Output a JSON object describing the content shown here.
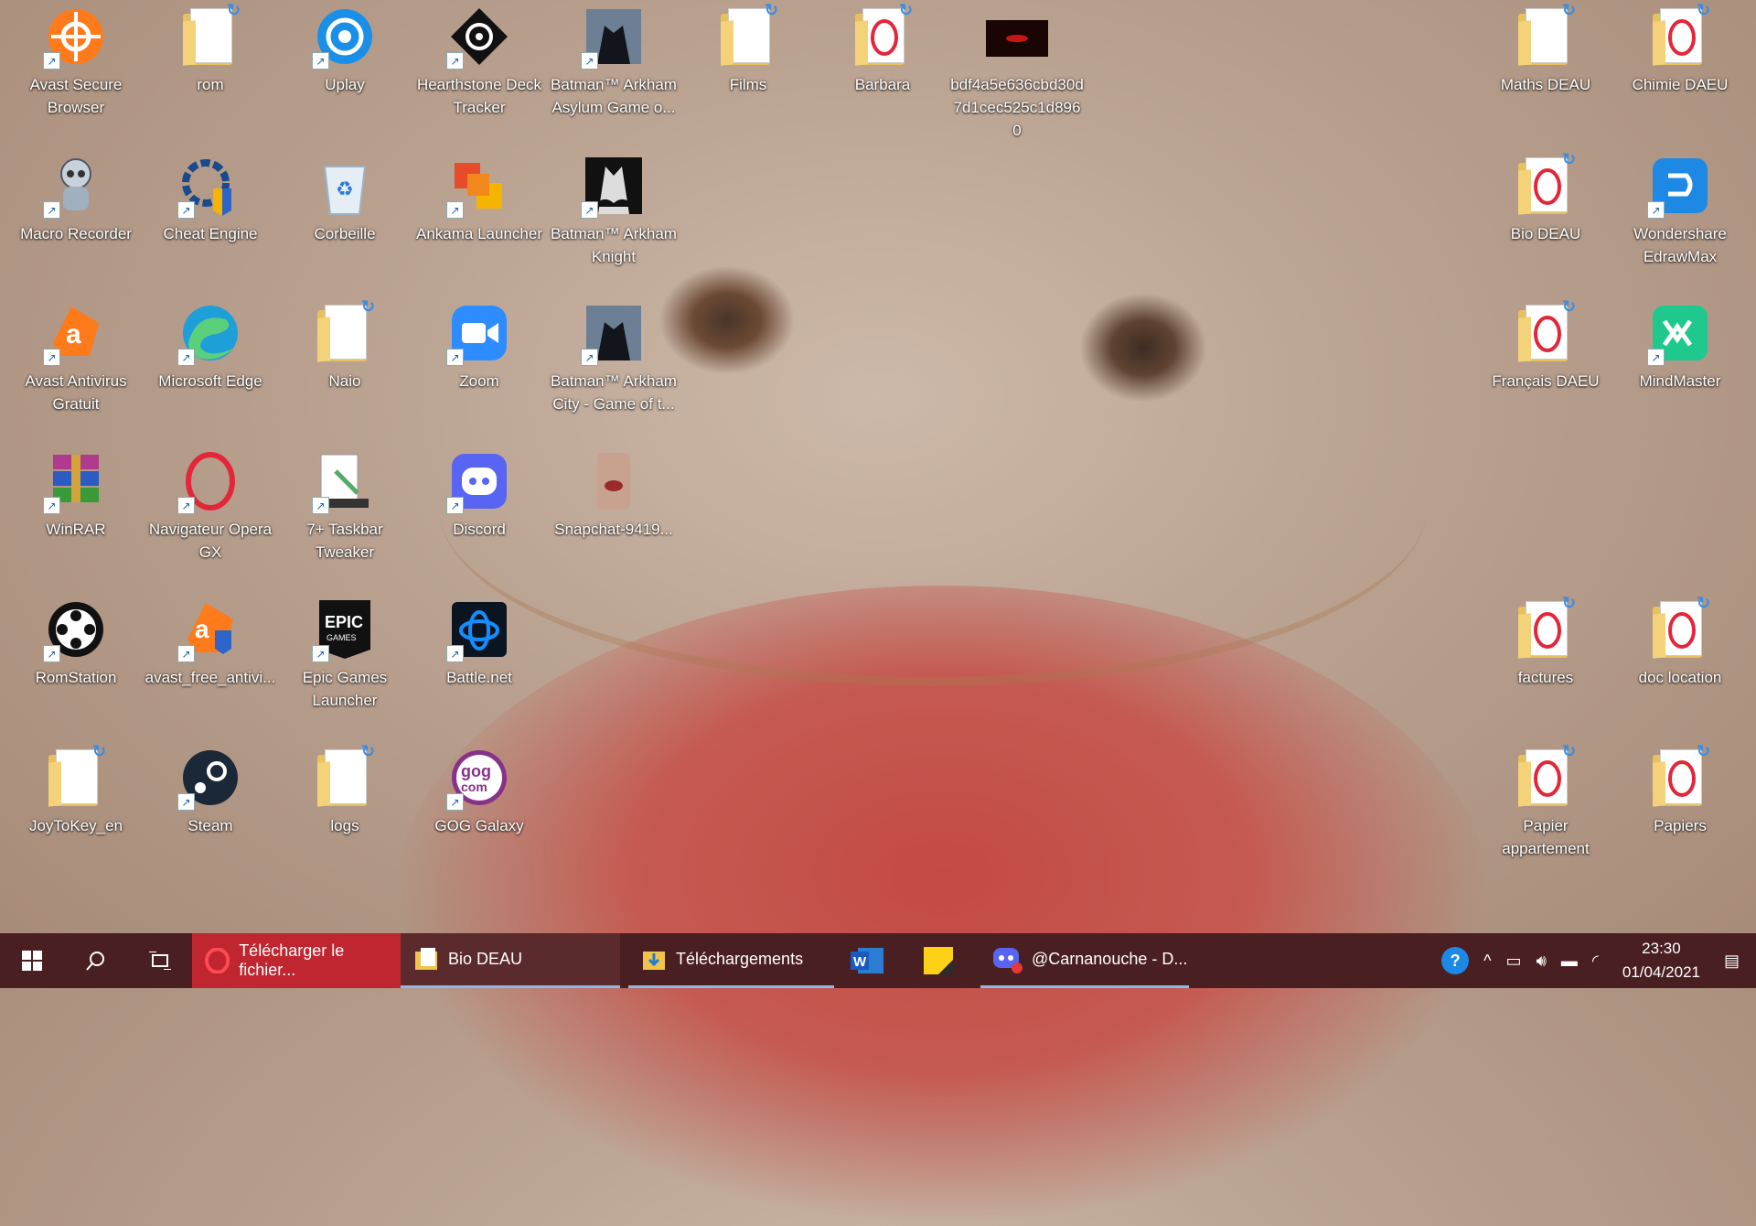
{
  "desktop": {
    "icons": [
      {
        "label": "Avast Secure Browser",
        "icon": "avast-secure-browser-icon",
        "color": "#ff7a1a"
      },
      {
        "label": "rom",
        "icon": "folder-icon"
      },
      {
        "label": "Uplay",
        "icon": "uplay-icon",
        "color": "#1a8fe8"
      },
      {
        "label": "Hearthstone Deck Tracker",
        "icon": "hearthstone-deck-tracker-icon"
      },
      {
        "label": "Batman™ Arkham Asylum Game o...",
        "icon": "batman-asylum-icon"
      },
      {
        "label": "Films",
        "icon": "folder-icon"
      },
      {
        "label": "Barbara",
        "icon": "folder-opera-icon"
      },
      {
        "label": "bdf4a5e636cbd30d7d1cec525c1d8960",
        "icon": "image-file-icon"
      },
      {
        "label": "Maths DEAU",
        "icon": "folder-icon"
      },
      {
        "label": "Chimie DAEU",
        "icon": "folder-opera-icon"
      },
      {
        "label": "Macro Recorder",
        "icon": "macro-recorder-icon"
      },
      {
        "label": "Cheat Engine",
        "icon": "cheat-engine-icon"
      },
      {
        "label": "Corbeille",
        "icon": "recycle-bin-icon"
      },
      {
        "label": "Ankama Launcher",
        "icon": "ankama-launcher-icon"
      },
      {
        "label": "Batman™ Arkham Knight",
        "icon": "batman-knight-icon"
      },
      {
        "label": "Bio DEAU",
        "icon": "folder-opera-icon"
      },
      {
        "label": "Wondershare EdrawMax",
        "icon": "edrawmax-icon",
        "color": "#1e88e5"
      },
      {
        "label": "Avast Antivirus Gratuit",
        "icon": "avast-antivirus-icon",
        "color": "#ff7a1a"
      },
      {
        "label": "Microsoft Edge",
        "icon": "edge-icon"
      },
      {
        "label": "Naio",
        "icon": "folder-icon"
      },
      {
        "label": "Zoom",
        "icon": "zoom-icon",
        "color": "#2d8cff"
      },
      {
        "label": "Batman™ Arkham City - Game of t...",
        "icon": "batman-city-icon"
      },
      {
        "label": "Français DAEU",
        "icon": "folder-opera-icon"
      },
      {
        "label": "MindMaster",
        "icon": "mindmaster-icon",
        "color": "#1fc98e"
      },
      {
        "label": "WinRAR",
        "icon": "winrar-icon"
      },
      {
        "label": "Navigateur Opera GX",
        "icon": "opera-gx-icon",
        "color": "#e3263a"
      },
      {
        "label": "7+ Taskbar Tweaker",
        "icon": "taskbar-tweaker-icon"
      },
      {
        "label": "Discord",
        "icon": "discord-icon",
        "color": "#5865f2"
      },
      {
        "label": "Snapchat-9419...",
        "icon": "snapchat-image-icon"
      },
      {
        "label": "RomStation",
        "icon": "romstation-icon"
      },
      {
        "label": "avast_free_antivi...",
        "icon": "avast-installer-icon",
        "color": "#ff7a1a"
      },
      {
        "label": "Epic Games Launcher",
        "icon": "epic-games-icon"
      },
      {
        "label": "Battle.net",
        "icon": "battlenet-icon",
        "color": "#148eff"
      },
      {
        "label": "factures",
        "icon": "folder-opera-icon"
      },
      {
        "label": "doc location",
        "icon": "folder-opera-icon"
      },
      {
        "label": "JoyToKey_en",
        "icon": "folder-icon"
      },
      {
        "label": "Steam",
        "icon": "steam-icon",
        "color": "#1b2838"
      },
      {
        "label": "logs",
        "icon": "folder-icon"
      },
      {
        "label": "GOG Galaxy",
        "icon": "gog-galaxy-icon",
        "color": "#86328a"
      },
      {
        "label": "Papier appartement",
        "icon": "folder-opera-icon"
      },
      {
        "label": "Papiers",
        "icon": "folder-opera-icon"
      }
    ]
  },
  "taskbar": {
    "apps": [
      {
        "label": "Télécharger le fichier...",
        "icon": "opera-icon"
      },
      {
        "label": "Bio DEAU",
        "icon": "folder-icon"
      },
      {
        "label": "Téléchargements",
        "icon": "folder-download-icon"
      },
      {
        "label": "",
        "icon": "word-icon"
      },
      {
        "label": "",
        "icon": "sticky-notes-icon"
      },
      {
        "label": "@Carnanouche - D...",
        "icon": "discord-icon"
      }
    ],
    "clock_time": "23:30",
    "clock_date": "01/04/2021",
    "colors": {
      "background": "#4a1f22",
      "active_app": "#c0262f"
    }
  }
}
